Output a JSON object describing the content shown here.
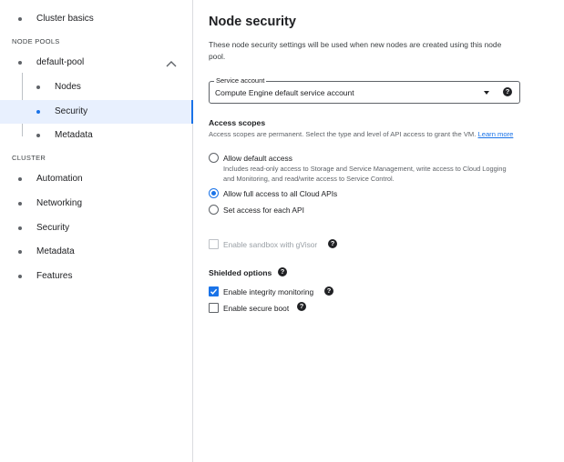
{
  "sidebar": {
    "items": [
      {
        "label": "Cluster basics"
      },
      {
        "label": "default-pool"
      },
      {
        "label": "Nodes"
      },
      {
        "label": "Security"
      },
      {
        "label": "Metadata"
      },
      {
        "label": "Automation"
      },
      {
        "label": "Networking"
      },
      {
        "label": "Security"
      },
      {
        "label": "Metadata"
      },
      {
        "label": "Features"
      }
    ],
    "sections": {
      "node_pools": "NODE POOLS",
      "cluster": "CLUSTER"
    },
    "active_item": "Security (node pool)",
    "accent_color": "#1a73e8"
  },
  "main": {
    "title": "Node security",
    "description": "These node security settings will be used when new nodes are created using this node pool.",
    "service_account": {
      "label": "Service account",
      "value": "Compute Engine default service account"
    },
    "access_scopes": {
      "heading": "Access scopes",
      "hint": "Access scopes are permanent. Select the type and level of API access to grant the VM.",
      "learn_more": "Learn more",
      "options": [
        {
          "label": "Allow default access",
          "sub": "Includes read-only access to Storage and Service Management, write access to Cloud Logging and Monitoring, and read/write access to Service Control.",
          "selected": false
        },
        {
          "label": "Allow full access to all Cloud APIs",
          "selected": true
        },
        {
          "label": "Set access for each API",
          "selected": false
        }
      ]
    },
    "sandbox": {
      "label": "Enable sandbox with gVisor",
      "checked": false,
      "disabled": true
    },
    "shielded": {
      "heading": "Shielded options",
      "options": [
        {
          "label": "Enable integrity monitoring",
          "checked": true
        },
        {
          "label": "Enable secure boot",
          "checked": false
        }
      ]
    },
    "help_glyph": "?"
  }
}
